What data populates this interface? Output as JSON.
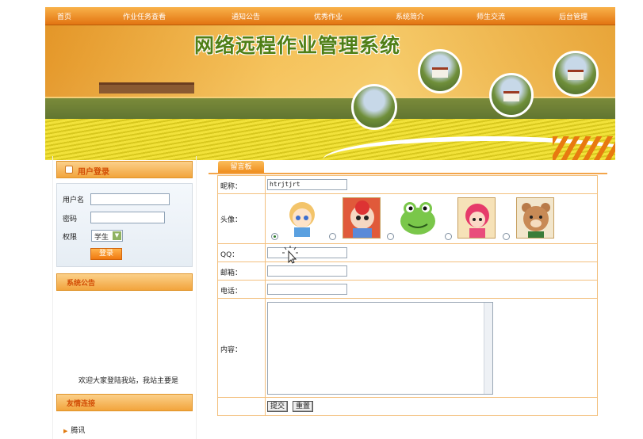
{
  "nav": {
    "items": [
      "首页",
      "作业任务查看",
      "通知公告",
      "优秀作业",
      "系统简介",
      "师生交流",
      "后台管理"
    ]
  },
  "banner": {
    "title": "网络远程作业管理系统"
  },
  "login": {
    "title": "用户登录",
    "username_label": "用户名",
    "username_value": "",
    "password_label": "密码",
    "password_value": "",
    "role_label": "权限",
    "role_selected": "学生",
    "submit_label": "登录"
  },
  "notice": {
    "title": "系统公告",
    "text": "欢迎大家登陆我站，我站主要是"
  },
  "links": {
    "title": "友情连接",
    "items": [
      "腾讯"
    ]
  },
  "board": {
    "tab_label": "留言板",
    "nickname_label": "昵称：",
    "nickname_value": "htrjtjrt",
    "avatar_label": "头像：",
    "avatars": [
      "girl-avatar",
      "doll-avatar",
      "frog-avatar",
      "pink-girl-avatar",
      "bear-avatar"
    ],
    "avatar_selected_index": 0,
    "qq_label": "QQ：",
    "qq_value": "",
    "email_label": "邮箱：",
    "email_value": "",
    "phone_label": "电话：",
    "phone_value": "",
    "content_label": "内容：",
    "content_value": "",
    "submit_label": "提交",
    "reset_label": "重置"
  },
  "colors": {
    "nav_orange": "#e27411",
    "heading_text": "#d24d05",
    "title_green": "#4f7f16",
    "border_light": "#f3c07e"
  }
}
